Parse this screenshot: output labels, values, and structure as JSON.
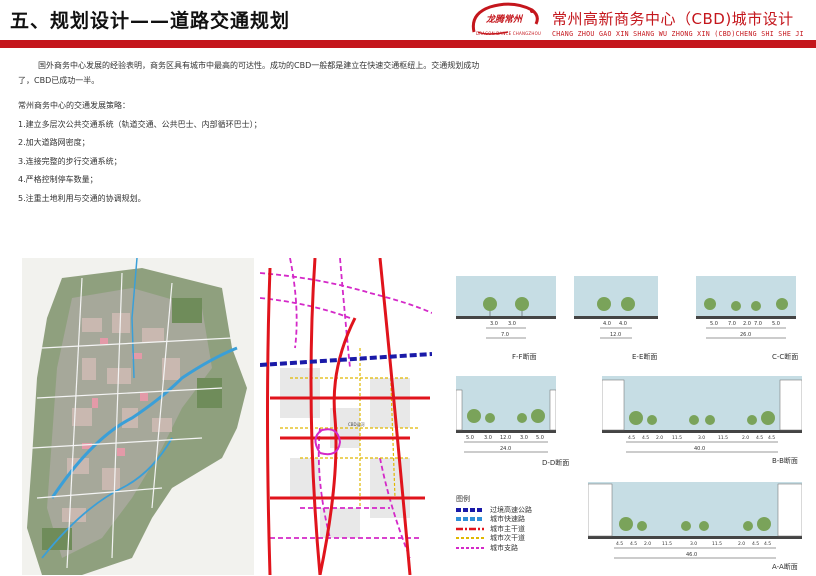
{
  "header": {
    "title": "五、规划设计——道路交通规划",
    "logo_text": "龙腾常州",
    "logo_subtext": "DRAGON DANCE CHANGZHOU",
    "project_title": "常州高新商务中心（CBD)城市设计",
    "project_pinyin": "CHANG ZHOU GAO XIN SHANG WU ZHONG XIN (CBD)CHENG SHI SHE JI",
    "accent_color": "#c4161c"
  },
  "intro": {
    "line1": "国外商务中心发展的经验表明，商务区具有城市中最高的可达性。成功的CBD一般都是建立在快速交通枢纽上。交通规划成功",
    "line2": "了，CBD已成功一半。"
  },
  "strategy": {
    "heading": "常州商务中心的交通发展策略：",
    "items": [
      "1.建立多层次公共交通系统（轨道交通、公共巴士、内部循环巴士）；",
      "2.加大道路网密度；",
      "3.连接完整的步行交通系统；",
      "4.严格控制停车数量；",
      "5.注重土地利用与交通的协调规划。"
    ]
  },
  "sections": {
    "f": {
      "label": "F-F断面",
      "dims": [
        "3.0",
        "3.0",
        "7.0"
      ]
    },
    "e": {
      "label": "E-E断面",
      "dims": [
        "4.0",
        "4.0",
        "12.0"
      ]
    },
    "c": {
      "label": "C-C断面",
      "dims": [
        "5.0",
        "7.0",
        "2.0",
        "7.0",
        "5.0",
        "26.0"
      ]
    },
    "d": {
      "label": "D-D断面",
      "dims": [
        "5.0",
        "3.0",
        "12.0",
        "3.0",
        "5.0",
        "24.0"
      ]
    },
    "b": {
      "label": "B-B断面",
      "dims": [
        "4.5",
        "4.5",
        "2.0",
        "11.5",
        "3.0",
        "11.5",
        "2.0",
        "4.5",
        "4.5",
        "40.0"
      ]
    },
    "a": {
      "label": "A-A断面",
      "dims": [
        "4.5",
        "4.5",
        "2.0",
        "11.5",
        "3.0",
        "11.5",
        "2.0",
        "4.5",
        "4.5",
        "46.0"
      ]
    }
  },
  "map_labels": {
    "canal": "CBD运河"
  },
  "legend": {
    "title": "图例",
    "items": [
      {
        "label": "过境高速公路",
        "color": "#1a1aa8",
        "style": "dashed-thick"
      },
      {
        "label": "城市快速路",
        "color": "#2e8fd8",
        "style": "dashed-thick"
      },
      {
        "label": "城市主干道",
        "color": "#e0141c",
        "style": "dash-dot"
      },
      {
        "label": "城市次干道",
        "color": "#e0b800",
        "style": "dashed"
      },
      {
        "label": "城市支路",
        "color": "#d429c8",
        "style": "dashed"
      }
    ]
  }
}
